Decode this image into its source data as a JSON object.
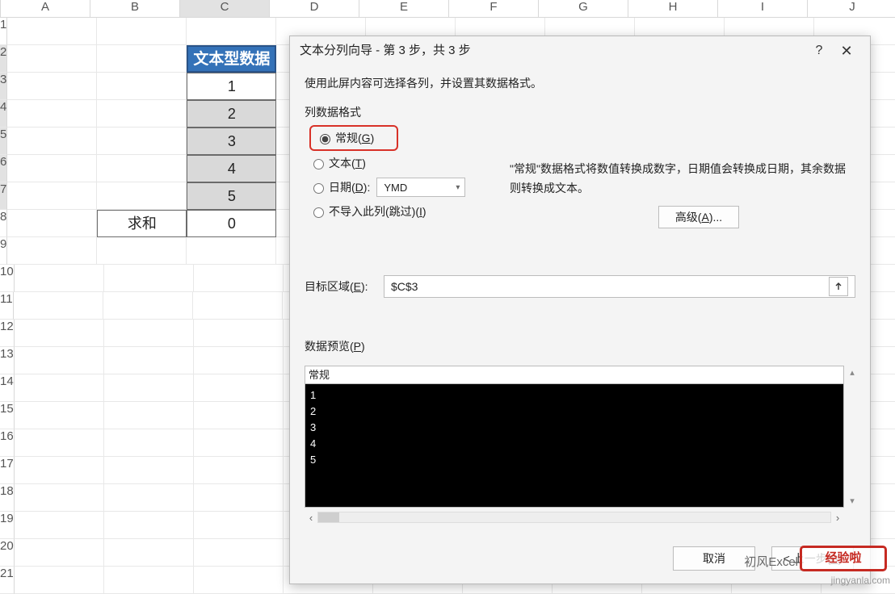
{
  "columns": [
    "A",
    "B",
    "C",
    "D",
    "E",
    "F",
    "G",
    "H",
    "I",
    "J"
  ],
  "selected_col_index": 2,
  "row_count": 21,
  "selected_rows": [
    2,
    3,
    4,
    5,
    6,
    7
  ],
  "table": {
    "header": "文本型数据",
    "values": [
      "1",
      "2",
      "3",
      "4",
      "5"
    ],
    "sum_label": "求和",
    "sum_value": "0"
  },
  "dialog": {
    "title": "文本分列向导 - 第 3 步，共 3 步",
    "help_label": "?",
    "close_label": "✕",
    "desc": "使用此屏内容可选择各列，并设置其数据格式。",
    "group_label": "列数据格式",
    "radios": {
      "general": "常规(G)",
      "text": "文本(T)",
      "date": "日期(D):",
      "skip": "不导入此列(跳过)(I)"
    },
    "date_format": "YMD",
    "explain": "\"常规\"数据格式将数值转换成数字，日期值会转换成日期，其余数据则转换成文本。",
    "advanced": "高级(A)...",
    "dest_label": "目标区域(E):",
    "dest_value": "$C$3",
    "preview_label": "数据预览(P)",
    "preview_header": "常规",
    "preview_rows": [
      "1",
      "2",
      "3",
      "4",
      "5"
    ],
    "buttons": {
      "cancel": "取消",
      "back": "< 上一步(B)"
    }
  },
  "watermark": {
    "logo1": "初风Excel",
    "box": "经验啦",
    "site": "jingyanla.com"
  },
  "chart_data": {
    "type": "table",
    "categories": [
      "文本型数据"
    ],
    "values": [
      1,
      2,
      3,
      4,
      5
    ],
    "sum": 0
  }
}
